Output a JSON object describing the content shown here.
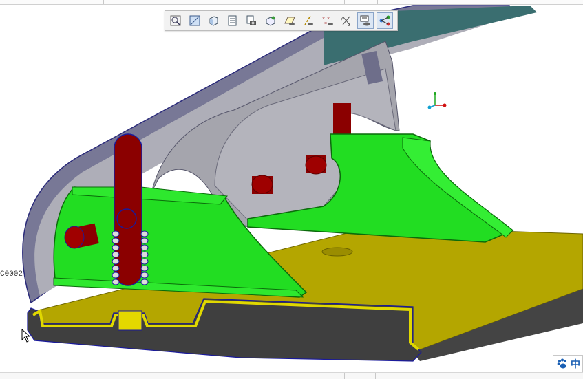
{
  "viewport": {
    "annotation_label": "C0002"
  },
  "toolbar": {
    "buttons": [
      {
        "icon": "zoom-fit-icon",
        "active": false
      },
      {
        "icon": "zoom-area-icon",
        "active": false
      },
      {
        "icon": "view-orientation-icon",
        "active": false
      },
      {
        "icon": "saved-views-icon",
        "active": false
      },
      {
        "icon": "snapshot-icon",
        "active": false
      },
      {
        "icon": "spin-center-icon",
        "active": false
      },
      {
        "icon": "datum-planes-icon",
        "active": false
      },
      {
        "icon": "datum-axes-icon",
        "active": false
      },
      {
        "icon": "datum-points-icon",
        "active": false
      },
      {
        "icon": "coordinate-systems-icon",
        "active": false
      },
      {
        "icon": "annotation-display-icon",
        "active": true
      },
      {
        "icon": "model-tree-icon",
        "active": true
      }
    ]
  },
  "ime": {
    "language_label": "中"
  },
  "colors": {
    "base_plate": "#b5a800",
    "bracket": "#22e022",
    "lever": "#a9a9b0",
    "pins": "#8b0000",
    "handle_shell": "#7b7b90",
    "handle_top": "#3a6e70"
  }
}
